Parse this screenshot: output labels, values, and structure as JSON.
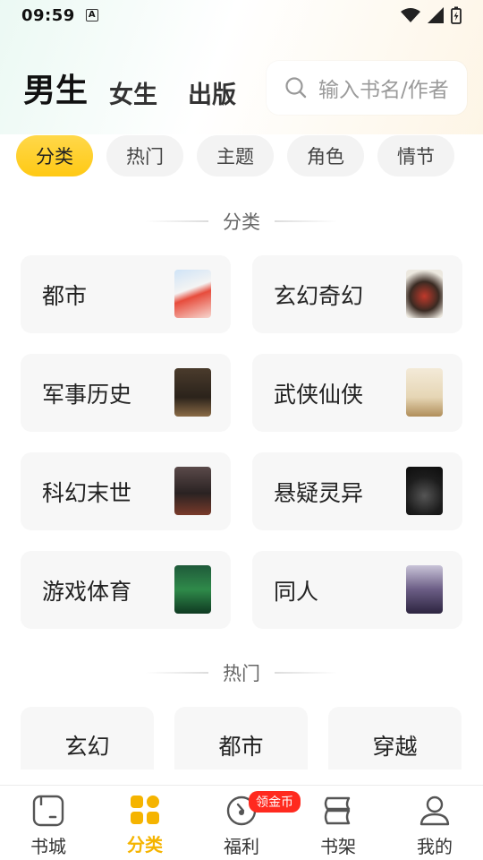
{
  "status_bar": {
    "time": "09:59",
    "a_badge": "A"
  },
  "header": {
    "tabs": [
      {
        "label": "男生",
        "active": true
      },
      {
        "label": "女生",
        "active": false
      },
      {
        "label": "出版",
        "active": false
      }
    ],
    "search": {
      "placeholder": "输入书名/作者"
    }
  },
  "filter_chips": [
    {
      "label": "分类",
      "active": true
    },
    {
      "label": "热门",
      "active": false
    },
    {
      "label": "主题",
      "active": false
    },
    {
      "label": "角色",
      "active": false
    },
    {
      "label": "情节",
      "active": false
    }
  ],
  "category_section": {
    "title": "分类",
    "items": [
      {
        "label": "都市"
      },
      {
        "label": "玄幻奇幻"
      },
      {
        "label": "军事历史"
      },
      {
        "label": "武侠仙侠"
      },
      {
        "label": "科幻末世"
      },
      {
        "label": "悬疑灵异"
      },
      {
        "label": "游戏体育"
      },
      {
        "label": "同人"
      }
    ]
  },
  "hot_section": {
    "title": "热门",
    "items": [
      {
        "label": "玄幻"
      },
      {
        "label": "都市"
      },
      {
        "label": "穿越"
      }
    ]
  },
  "bottom_nav": {
    "items": [
      {
        "label": "书城",
        "active": false
      },
      {
        "label": "分类",
        "active": true
      },
      {
        "label": "福利",
        "active": false,
        "badge": "领金币"
      },
      {
        "label": "书架",
        "active": false
      },
      {
        "label": "我的",
        "active": false
      }
    ]
  },
  "colors": {
    "accent": "#ffc914",
    "badge": "#ff2a1f"
  }
}
